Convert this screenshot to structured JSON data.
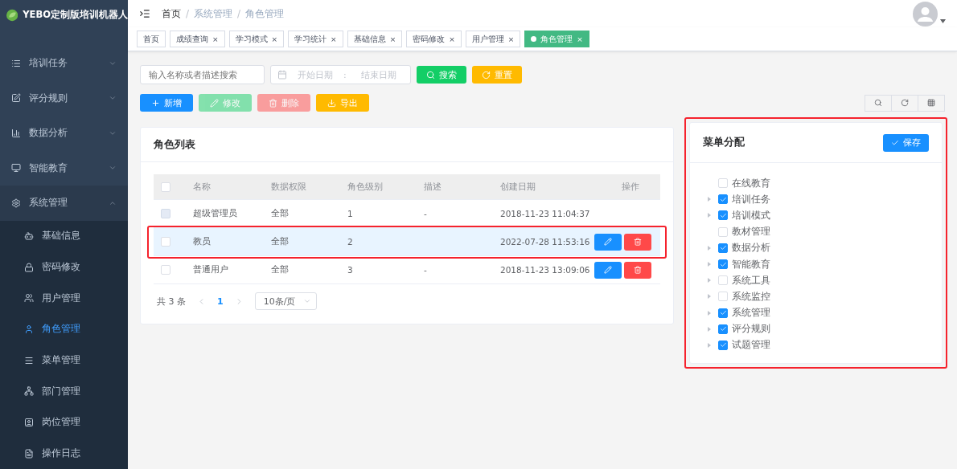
{
  "app": {
    "title": "YEBO定制版培训机器人"
  },
  "sidebar": {
    "items": [
      {
        "label": "培训任务",
        "expanded": false,
        "selected": false
      },
      {
        "label": "评分规则",
        "expanded": false,
        "selected": false
      },
      {
        "label": "数据分析",
        "expanded": false,
        "selected": false
      },
      {
        "label": "智能教育",
        "expanded": false,
        "selected": false
      },
      {
        "label": "系统管理",
        "expanded": true,
        "selected": false,
        "children": [
          {
            "label": "基础信息",
            "selected": false
          },
          {
            "label": "密码修改",
            "selected": false
          },
          {
            "label": "用户管理",
            "selected": false
          },
          {
            "label": "角色管理",
            "selected": true
          },
          {
            "label": "菜单管理",
            "selected": false
          },
          {
            "label": "部门管理",
            "selected": false
          },
          {
            "label": "岗位管理",
            "selected": false
          },
          {
            "label": "操作日志",
            "selected": false
          }
        ]
      }
    ]
  },
  "breadcrumb": [
    {
      "label": "首页"
    },
    {
      "separator": "/",
      "label": "系统管理"
    },
    {
      "separator": "/",
      "label": "角色管理"
    }
  ],
  "tags": [
    {
      "label": "首页",
      "selected": false
    },
    {
      "label": "成绩查询",
      "close": "×",
      "selected": false
    },
    {
      "label": "学习模式",
      "close": "×",
      "selected": false
    },
    {
      "label": "学习统计",
      "close": "×",
      "selected": false
    },
    {
      "label": "基础信息",
      "close": "×",
      "selected": false
    },
    {
      "label": "密码修改",
      "close": "×",
      "selected": false
    },
    {
      "label": "用户管理",
      "close": "×",
      "selected": false
    },
    {
      "label": "角色管理",
      "close": "×",
      "selected": true
    }
  ],
  "search": {
    "placeholder": "输入名称或者描述搜索",
    "start_placeholder": "开始日期",
    "separator": ":",
    "end_placeholder": "结束日期",
    "search_button": "搜索",
    "reset_button": "重置"
  },
  "actions": [
    {
      "label": "新增",
      "kind": "add",
      "disabled": false
    },
    {
      "label": "修改",
      "kind": "edit",
      "disabled": true
    },
    {
      "label": "删除",
      "kind": "delete",
      "disabled": true
    },
    {
      "label": "导出",
      "kind": "export",
      "disabled": false
    }
  ],
  "role_list": {
    "title": "角色列表",
    "select_all_checked": false,
    "columns": [
      "名称",
      "数据权限",
      "角色级别",
      "描述",
      "创建日期",
      "操作"
    ],
    "rows": [
      {
        "name": "超级管理员",
        "scope": "全部",
        "level": "1",
        "description": "-",
        "created": "2018-11-23 11:04:37",
        "checkbox_disabled": true,
        "checked": false,
        "selected": false,
        "highlighted": false,
        "editable": false
      },
      {
        "name": "教员",
        "scope": "全部",
        "level": "2",
        "created": "2022-07-28 11:53:16",
        "checkbox_disabled": false,
        "checked": false,
        "selected": true,
        "highlighted": true,
        "editable": true
      },
      {
        "name": "普通用户",
        "scope": "全部",
        "level": "3",
        "description": "-",
        "created": "2018-11-23 13:09:06",
        "checkbox_disabled": false,
        "checked": false,
        "selected": false,
        "highlighted": false,
        "editable": true
      }
    ],
    "pagination": {
      "total": "共 3 条",
      "pages": [
        {
          "label": "1",
          "selected": true
        }
      ],
      "page_size": "10条/页"
    }
  },
  "menu_assign": {
    "title": "菜单分配",
    "save_button": "保存",
    "highlighted": true,
    "items": [
      {
        "label": "在线教育",
        "checked": false,
        "expandable": false
      },
      {
        "label": "培训任务",
        "checked": true,
        "expandable": true
      },
      {
        "label": "培训模式",
        "checked": true,
        "expandable": true
      },
      {
        "label": "教材管理",
        "checked": false,
        "expandable": false
      },
      {
        "label": "数据分析",
        "checked": true,
        "expandable": true
      },
      {
        "label": "智能教育",
        "checked": true,
        "expandable": true
      },
      {
        "label": "系统工具",
        "checked": false,
        "expandable": true
      },
      {
        "label": "系统监控",
        "checked": false,
        "expandable": true
      },
      {
        "label": "系统管理",
        "checked": true,
        "expandable": true
      },
      {
        "label": "评分规则",
        "checked": true,
        "expandable": true
      },
      {
        "label": "试题管理",
        "checked": true,
        "expandable": true
      }
    ]
  }
}
